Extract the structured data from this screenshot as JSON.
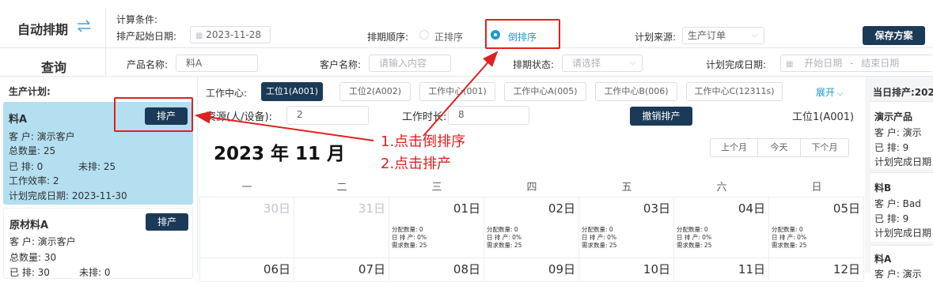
{
  "header": {
    "title": "自动排期",
    "query_label": "查询",
    "calc_conditions_label": "计算条件:",
    "start_date_label": "排产起始日期:",
    "start_date_value": "2023-11-28",
    "order_label": "排期顺序:",
    "order_options": [
      "正排序",
      "倒排序"
    ],
    "order_selected": "倒排序",
    "source_label": "计划来源:",
    "source_value": "生产订单",
    "save_button": "保存方案"
  },
  "filters": {
    "product_label": "产品名称:",
    "product_value": "料A",
    "customer_label": "客户名称:",
    "customer_placeholder": "请输入内容",
    "status_label": "排期状态:",
    "status_placeholder": "请选择",
    "complete_date_label": "计划完成日期:",
    "start_placeholder": "开始日期",
    "range_sep": "-",
    "end_placeholder": "结束日期"
  },
  "left_panel": {
    "title": "生产计划:",
    "cards": [
      {
        "name": "料A",
        "button": "排产",
        "customer": "客    户: 演示客户",
        "total": "总数量: 25",
        "scheduled": "已    排: 0",
        "unscheduled": "未排: 25",
        "efficiency": "工作效率: 2",
        "complete_date": "计划完成日期: 2023-11-30"
      },
      {
        "name": "原材料A",
        "button": "排产",
        "customer": "客    户: 演示客户",
        "total": "总数量: 30",
        "scheduled": "已    排: 30",
        "unscheduled": "未排: 0"
      }
    ]
  },
  "workcenter": {
    "label": "工作中心:",
    "tabs": [
      "工位1(A001)",
      "工位2(A002)",
      "工作中心(001)",
      "工作中心A(005)",
      "工作中心B(006)",
      "工作中心C(12311s)"
    ],
    "active_tab": "工位1(A001)",
    "expand": "展开",
    "resource_label": "资源(人/设备):",
    "resource_value": "2",
    "hours_label": "工作时长:",
    "hours_value": "8",
    "cancel_button": "撤销排产",
    "current": "工位1(A001)"
  },
  "calendar": {
    "month_title": "2023 年 11 月",
    "nav": [
      "上个月",
      "今天",
      "下个月"
    ],
    "weekdays": [
      "一",
      "二",
      "三",
      "四",
      "五",
      "六",
      "日"
    ],
    "row1": [
      "30日",
      "31日",
      "01日",
      "02日",
      "03日",
      "04日",
      "05日"
    ],
    "row2": [
      "06日",
      "07日",
      "08日",
      "09日",
      "10日",
      "11日",
      "12日"
    ],
    "stat_lines": [
      "分配数量: 0",
      "日 排 产: 0%",
      "需求数量: 25"
    ]
  },
  "annotation": {
    "line1": "1.点击倒排序",
    "line2": "2.点击排产",
    "color": "#e02020"
  },
  "right_panel": {
    "title": "当日排产:202",
    "cards": [
      {
        "name": "演示产品",
        "customer": "客    户: 演示",
        "scheduled": "已    排: 9",
        "complete": "计划完成日期"
      },
      {
        "name": "料B",
        "customer": "客    户: Bad",
        "scheduled": "已    排: 9",
        "complete": "计划完成日期"
      },
      {
        "name": "料A",
        "customer": "客    户: 演示"
      }
    ]
  }
}
